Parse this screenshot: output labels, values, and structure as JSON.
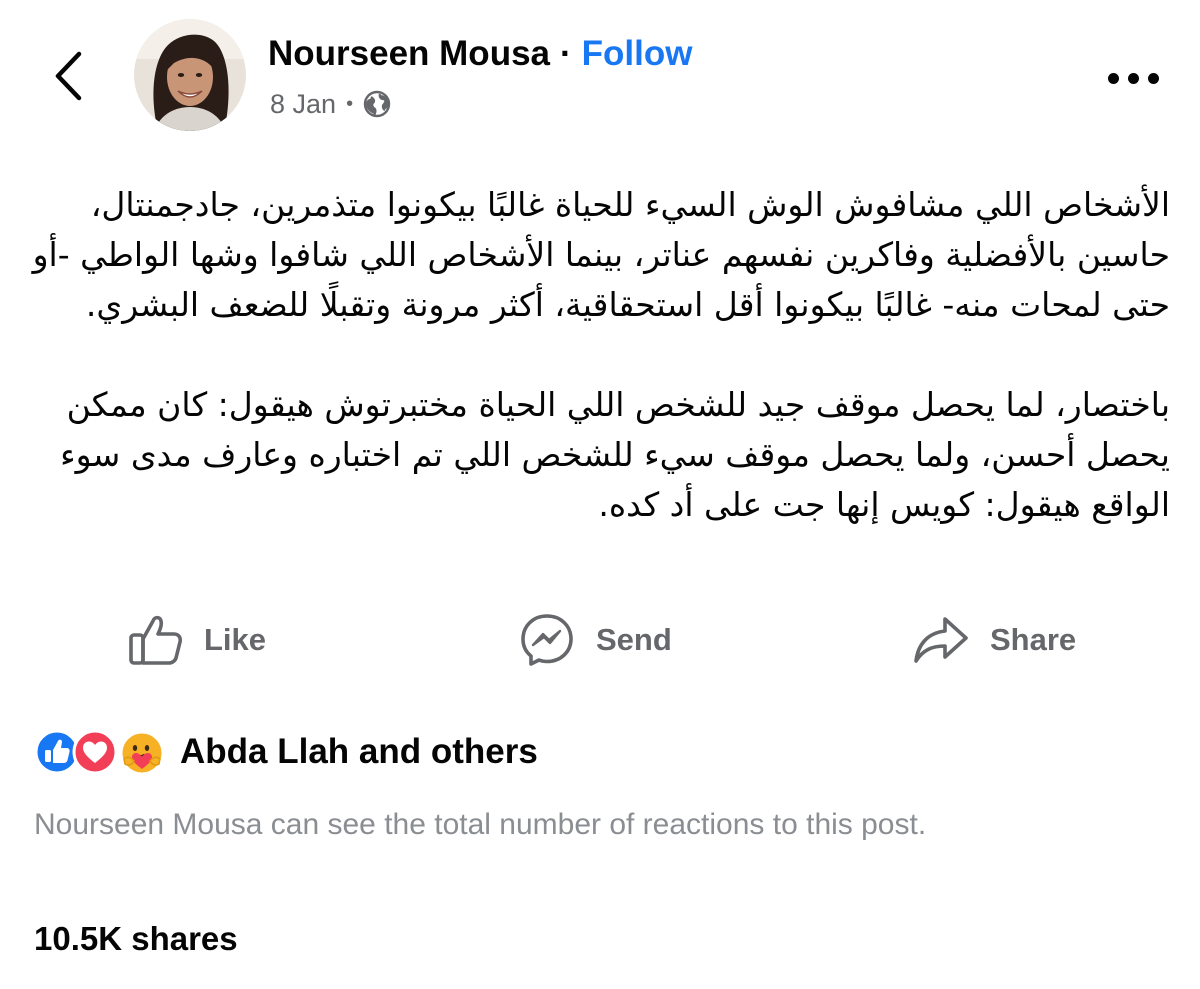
{
  "header": {
    "author_name": "Nourseen Mousa",
    "separator": "·",
    "follow_label": "Follow",
    "date": "8 Jan",
    "meta_separator": "•",
    "audience_icon": "globe-icon",
    "back_icon": "chevron-left-icon",
    "more_icon": "more-horizontal-icon"
  },
  "post": {
    "paragraphs": [
      "الأشخاص اللي مشافوش الوش السيء للحياة غالبًا بيكونوا متذمرين، جادجمنتال، حاسين بالأفضلية وفاكرين نفسهم عناتر، بينما الأشخاص اللي شافوا وشها الواطي -أو حتى لمحات منه- غالبًا بيكونوا أقل استحقاقية، أكثر مرونة وتقبلًا للضعف البشري.",
      "باختصار، لما يحصل موقف جيد للشخص اللي الحياة مختبرتوش هيقول: كان ممكن يحصل أحسن، ولما يحصل موقف سيء للشخص اللي تم اختباره وعارف مدى سوء الواقع هيقول: كويس إنها جت على أد كده."
    ]
  },
  "actions": {
    "like_label": "Like",
    "send_label": "Send",
    "share_label": "Share",
    "like_icon": "thumbs-up-icon",
    "send_icon": "messenger-icon",
    "share_icon": "share-arrow-icon"
  },
  "reactions": {
    "icons": [
      "like-reaction-icon",
      "love-reaction-icon",
      "care-reaction-icon"
    ],
    "summary": "Abda Llah and others",
    "note": "Nourseen Mousa can see the total number of reactions to this post."
  },
  "shares": {
    "count_label": "10.5K shares"
  },
  "colors": {
    "accent": "#1877f2",
    "secondary_text": "#65676b",
    "muted_text": "#8a8d91",
    "primary_text": "#050505",
    "love_red": "#f33e58",
    "care_yellow": "#f7b125"
  }
}
